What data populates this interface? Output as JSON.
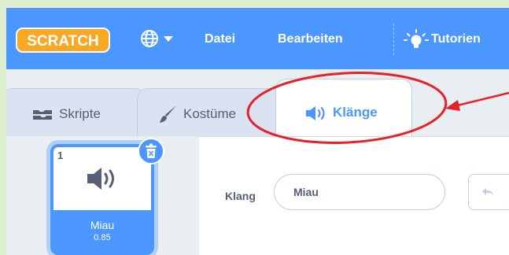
{
  "menubar": {
    "logo_text": "SCRATCH",
    "items": {
      "file": "Datei",
      "edit": "Bearbeiten",
      "tutorials": "Tutorien"
    }
  },
  "tabs": [
    {
      "label": "Skripte",
      "icon": "code-icon",
      "active": false
    },
    {
      "label": "Kostüme",
      "icon": "paintbrush-icon",
      "active": false
    },
    {
      "label": "Klänge",
      "icon": "speaker-icon",
      "active": true
    }
  ],
  "sound_list": [
    {
      "index": "1",
      "name": "Miau",
      "duration": "0.85",
      "selected": true
    }
  ],
  "editor": {
    "sound_label": "Klang",
    "sound_name": "Miau"
  },
  "colors": {
    "primary": "#4c97ff",
    "annotation": "#e8202a",
    "outer_background": "#dff0d0"
  }
}
